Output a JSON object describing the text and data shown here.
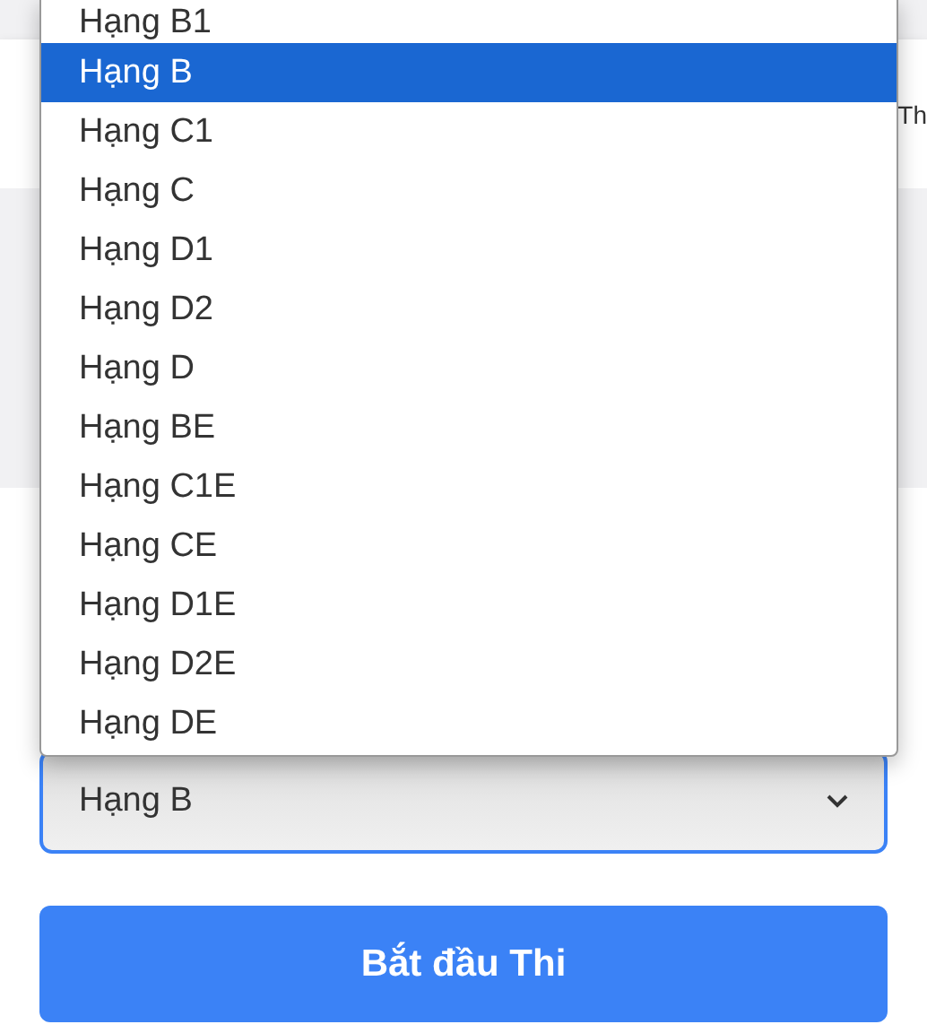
{
  "header": {
    "text": "Th"
  },
  "dropdown_options": [
    {
      "label": "Hạng B1",
      "selected": false
    },
    {
      "label": "Hạng B",
      "selected": true
    },
    {
      "label": "Hạng C1",
      "selected": false
    },
    {
      "label": "Hạng C",
      "selected": false
    },
    {
      "label": "Hạng D1",
      "selected": false
    },
    {
      "label": "Hạng D2",
      "selected": false
    },
    {
      "label": "Hạng D",
      "selected": false
    },
    {
      "label": "Hạng BE",
      "selected": false
    },
    {
      "label": "Hạng C1E",
      "selected": false
    },
    {
      "label": "Hạng CE",
      "selected": false
    },
    {
      "label": "Hạng D1E",
      "selected": false
    },
    {
      "label": "Hạng D2E",
      "selected": false
    },
    {
      "label": "Hạng DE",
      "selected": false
    }
  ],
  "license_select": {
    "value": "Hạng B"
  },
  "start_button": {
    "label": "Bắt đầu Thi"
  }
}
